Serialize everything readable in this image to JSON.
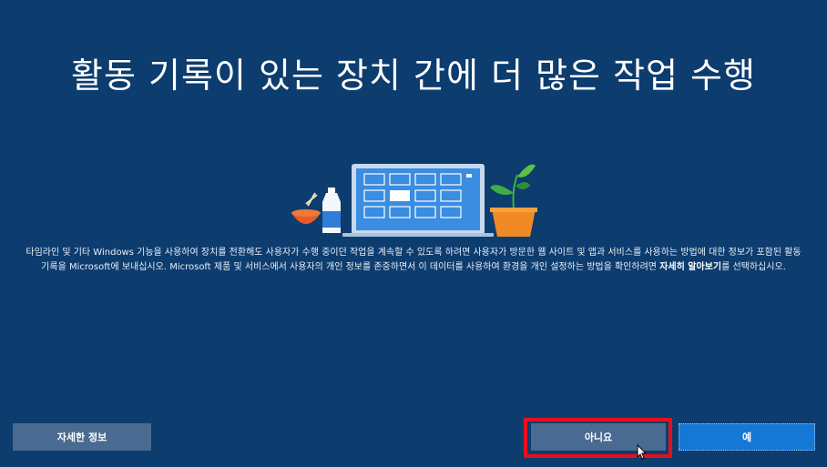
{
  "title": "활동 기록이 있는 장치 간에 더 많은 작업 수행",
  "description": {
    "text": "타임라인 및 기타 Windows 기능을 사용하여 장치를 전환해도 사용자가 수행 중이던 작업을 계속할 수 있도록 하려면 사용자가 방문한 웹 사이트 및 앱과 서비스를 사용하는 방법에 대한 정보가 포함된 활동 기록을 Microsoft에 보내십시오. Microsoft 제품 및 서비스에서 사용자의 개인 정보를 존중하면서 이 데이터를 사용하여 환경을 개인 설정하는 방법을 확인하려면 ",
    "link": "자세히 알아보기",
    "suffix": "를 선택하십시오."
  },
  "buttons": {
    "details": "자세한 정보",
    "no": "아니요",
    "yes": "예"
  },
  "colors": {
    "background": "#0d3c6e",
    "highlight": "#e8101c",
    "primary_button": "#1478d4",
    "secondary_button": "#4a6b91"
  },
  "icons": [
    "laptop-icon",
    "bowl-icon",
    "milk-bottle-icon",
    "plant-icon"
  ]
}
